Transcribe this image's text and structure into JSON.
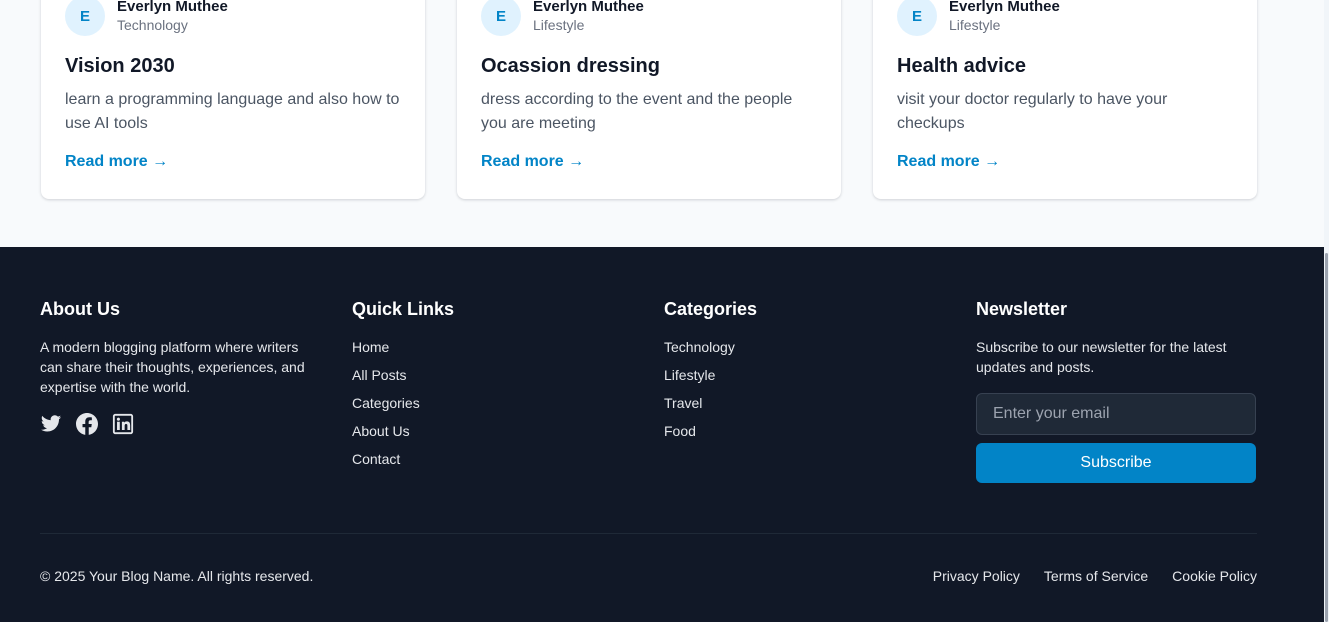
{
  "cards": [
    {
      "avatar_letter": "E",
      "author": "Everlyn Muthee",
      "category": "Technology",
      "title": "Vision 2030",
      "excerpt": "learn a programming language and also how to use AI tools",
      "read_more": "Read more →"
    },
    {
      "avatar_letter": "E",
      "author": "Everlyn Muthee",
      "category": "Lifestyle",
      "title": "Ocassion dressing",
      "excerpt": "dress according to the event and the people you are meeting",
      "read_more": "Read more →"
    },
    {
      "avatar_letter": "E",
      "author": "Everlyn Muthee",
      "category": "Lifestyle",
      "title": "Health advice",
      "excerpt": "visit your doctor regularly to have your checkups",
      "read_more": "Read more →"
    }
  ],
  "footer": {
    "about": {
      "heading": "About Us",
      "text": "A modern blogging platform where writers can share their thoughts, experiences, and expertise with the world.",
      "socials": [
        "twitter-icon",
        "facebook-icon",
        "linkedin-icon"
      ]
    },
    "quick_links": {
      "heading": "Quick Links",
      "items": [
        "Home",
        "All Posts",
        "Categories",
        "About Us",
        "Contact"
      ]
    },
    "categories": {
      "heading": "Categories",
      "items": [
        "Technology",
        "Lifestyle",
        "Travel",
        "Food"
      ]
    },
    "newsletter": {
      "heading": "Newsletter",
      "text": "Subscribe to our newsletter for the latest updates and posts.",
      "placeholder": "Enter your email",
      "button": "Subscribe"
    },
    "copyright": "© 2025 Your Blog Name. All rights reserved.",
    "legal": [
      "Privacy Policy",
      "Terms of Service",
      "Cookie Policy"
    ]
  },
  "colors": {
    "accent": "#0284c7",
    "footer_bg": "#111827",
    "page_bg": "#f8fafc"
  }
}
